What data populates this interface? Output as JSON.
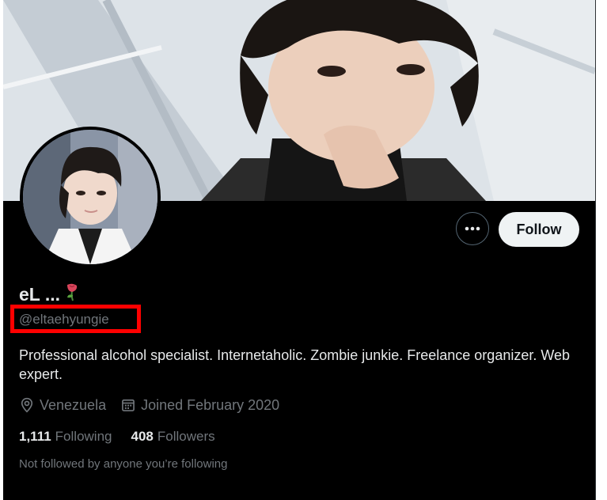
{
  "profile": {
    "display_name": "eL ...",
    "name_emoji": "🥀",
    "handle": "@eltaehyungie",
    "bio": "Professional alcohol specialist. Internetaholic. Zombie junkie. Freelance organizer. Web expert.",
    "location": "Venezuela",
    "joined": "Joined February 2020",
    "following_count": "1,111",
    "following_label": "Following",
    "followers_count": "408",
    "followers_label": "Followers",
    "not_followed_text": "Not followed by anyone you’re following"
  },
  "actions": {
    "follow_label": "Follow",
    "more_icon": "more-horizontal-icon"
  },
  "icons": {
    "location": "location-pin-icon",
    "calendar": "calendar-icon"
  },
  "colors": {
    "background": "#000000",
    "primary_text": "#e7e9ea",
    "secondary_text": "#71767b",
    "follow_button_bg": "#eff3f4",
    "highlight_box": "#ff0000"
  }
}
